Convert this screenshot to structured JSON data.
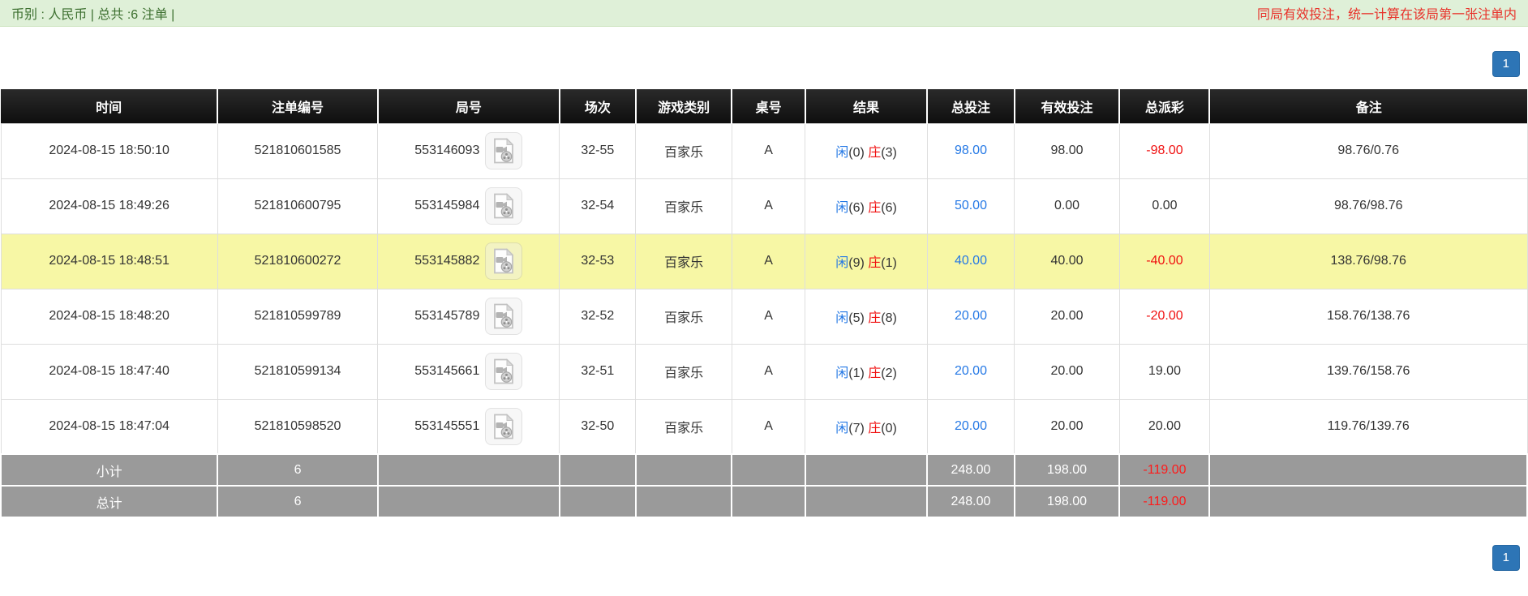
{
  "topbar": {
    "summary": "币别 : 人民币 | 总共 :6 注单 |",
    "notice": "同局有效投注，统一计算在该局第一张注单内"
  },
  "pagination": {
    "page": "1"
  },
  "table": {
    "headers": [
      "时间",
      "注单编号",
      "局号",
      "场次",
      "游戏类别",
      "桌号",
      "结果",
      "总投注",
      "有效投注",
      "总派彩",
      "备注"
    ],
    "highlighted_row": 2,
    "rows": [
      {
        "time": "2024-08-15 18:50:10",
        "bet_id": "521810601585",
        "round_id": "553146093",
        "session": "32-55",
        "game_type": "百家乐",
        "table_no": "A",
        "result_player": "闲",
        "result_player_n": "(0)",
        "result_banker": "庄",
        "result_banker_n": "(3)",
        "total_bet": "98.00",
        "valid_bet": "98.00",
        "payout": "-98.00",
        "remark": "98.76/0.76"
      },
      {
        "time": "2024-08-15 18:49:26",
        "bet_id": "521810600795",
        "round_id": "553145984",
        "session": "32-54",
        "game_type": "百家乐",
        "table_no": "A",
        "result_player": "闲",
        "result_player_n": "(6)",
        "result_banker": "庄",
        "result_banker_n": "(6)",
        "total_bet": "50.00",
        "valid_bet": "0.00",
        "payout": "0.00",
        "remark": "98.76/98.76"
      },
      {
        "time": "2024-08-15 18:48:51",
        "bet_id": "521810600272",
        "round_id": "553145882",
        "session": "32-53",
        "game_type": "百家乐",
        "table_no": "A",
        "result_player": "闲",
        "result_player_n": "(9)",
        "result_banker": "庄",
        "result_banker_n": "(1)",
        "total_bet": "40.00",
        "valid_bet": "40.00",
        "payout": "-40.00",
        "remark": "138.76/98.76"
      },
      {
        "time": "2024-08-15 18:48:20",
        "bet_id": "521810599789",
        "round_id": "553145789",
        "session": "32-52",
        "game_type": "百家乐",
        "table_no": "A",
        "result_player": "闲",
        "result_player_n": "(5)",
        "result_banker": "庄",
        "result_banker_n": "(8)",
        "total_bet": "20.00",
        "valid_bet": "20.00",
        "payout": "-20.00",
        "remark": "158.76/138.76"
      },
      {
        "time": "2024-08-15 18:47:40",
        "bet_id": "521810599134",
        "round_id": "553145661",
        "session": "32-51",
        "game_type": "百家乐",
        "table_no": "A",
        "result_player": "闲",
        "result_player_n": "(1)",
        "result_banker": "庄",
        "result_banker_n": "(2)",
        "total_bet": "20.00",
        "valid_bet": "20.00",
        "payout": "19.00",
        "remark": "139.76/158.76"
      },
      {
        "time": "2024-08-15 18:47:04",
        "bet_id": "521810598520",
        "round_id": "553145551",
        "session": "32-50",
        "game_type": "百家乐",
        "table_no": "A",
        "result_player": "闲",
        "result_player_n": "(7)",
        "result_banker": "庄",
        "result_banker_n": "(0)",
        "total_bet": "20.00",
        "valid_bet": "20.00",
        "payout": "20.00",
        "remark": "119.76/139.76"
      }
    ],
    "subtotal": {
      "label": "小计",
      "count": "6",
      "total_bet": "248.00",
      "valid_bet": "198.00",
      "payout": "-119.00"
    },
    "total": {
      "label": "总计",
      "count": "6",
      "total_bet": "248.00",
      "valid_bet": "198.00",
      "payout": "-119.00"
    }
  },
  "icons": {
    "video": "video-replay-icon"
  },
  "colors": {
    "accent-blue": "#2478e5",
    "accent-red": "#f01010",
    "highlight-yellow": "#f7f7a5",
    "topbar-bg": "#dff0d8",
    "topbar-text": "#3d7030",
    "notice-red": "#e8322a",
    "footer-gray": "#9a9a9a",
    "pager-blue": "#2d75b6"
  }
}
